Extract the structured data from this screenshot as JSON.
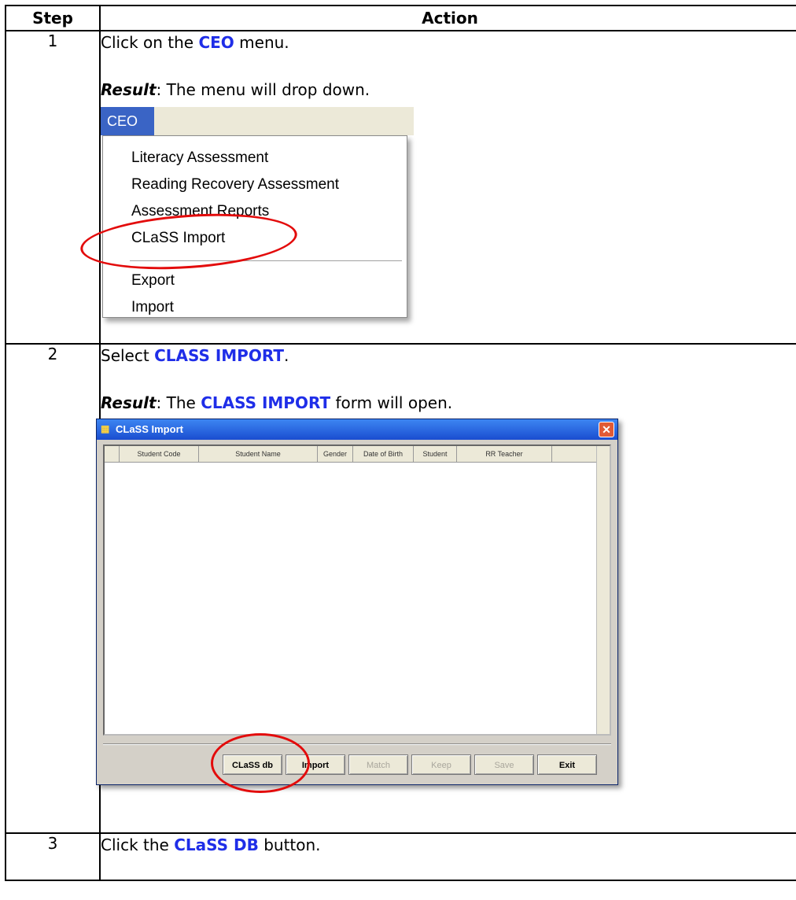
{
  "table": {
    "header_step": "Step",
    "header_action": "Action"
  },
  "rows": [
    {
      "step": "1",
      "line1_pre": "Click on the ",
      "line1_kw": "CEO",
      "line1_post": " menu.",
      "result_label": "Result",
      "result_text": ": The menu will drop down."
    },
    {
      "step": "2",
      "line1_pre": "Select ",
      "line1_kw": "CLASS IMPORT",
      "line1_post": ".",
      "result_label": "Result",
      "result_pre": ":  The ",
      "result_kw": "CLASS IMPORT",
      "result_post": " form will open."
    },
    {
      "step": "3",
      "line1_pre": "Click the ",
      "line1_kw": "CLaSS DB",
      "line1_post": " button."
    }
  ],
  "ceo_menu": {
    "tab_label": "CEO",
    "items": [
      "Literacy Assessment",
      "Reading Recovery Assessment",
      "Assessment Reports",
      "CLaSS Import",
      "Export",
      "Import"
    ],
    "highlighted_item": "CLaSS Import",
    "highlight_color": "#e30b0b",
    "tab_color": "#3a64c5"
  },
  "class_import_dialog": {
    "title": "CLaSS Import",
    "columns": [
      "Student Code",
      "Student Name",
      "Gender",
      "Date of Birth",
      "Student",
      "RR Teacher"
    ],
    "buttons": [
      {
        "label": "CLaSS db",
        "enabled": true
      },
      {
        "label": "Import",
        "enabled": true
      },
      {
        "label": "Match",
        "enabled": false
      },
      {
        "label": "Keep",
        "enabled": false
      },
      {
        "label": "Save",
        "enabled": false
      },
      {
        "label": "Exit",
        "enabled": true
      }
    ],
    "highlighted_button": "CLaSS db",
    "title_bar_color": "#1a4dd0"
  },
  "colors": {
    "keyword": "#1f2ee8",
    "annotation_ring": "#e30b0b"
  }
}
